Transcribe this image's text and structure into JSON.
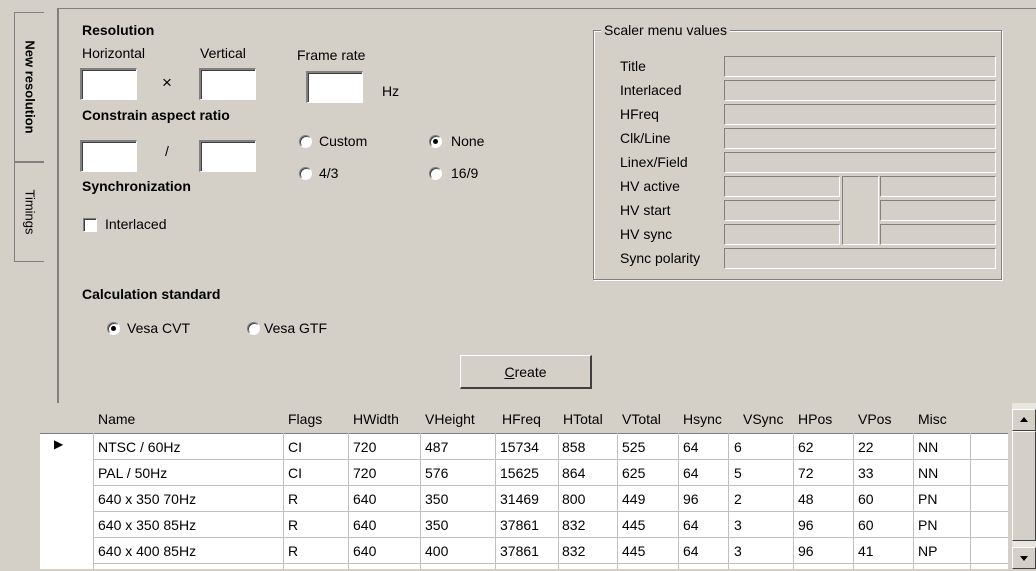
{
  "tabs": [
    "New resolution",
    "Timings"
  ],
  "resolution": {
    "heading": "Resolution",
    "horizontal_label": "Horizontal",
    "vertical_label": "Vertical",
    "horizontal_value": "",
    "vertical_value": "",
    "times": "×",
    "frame_rate_label": "Frame rate",
    "frame_rate_value": "",
    "hz": "Hz"
  },
  "aspect": {
    "heading": "Constrain aspect ratio",
    "slash": "/",
    "num_value": "",
    "den_value": "",
    "options": [
      {
        "label": "Custom",
        "selected": false
      },
      {
        "label": "None",
        "selected": true
      },
      {
        "label": "4/3",
        "selected": false
      },
      {
        "label": "16/9",
        "selected": false
      }
    ]
  },
  "sync": {
    "heading": "Synchronization",
    "interlaced_label": "Interlaced",
    "interlaced_checked": false
  },
  "calc": {
    "heading": "Calculation standard",
    "options": [
      {
        "label": "Vesa CVT",
        "selected": true
      },
      {
        "label": "Vesa GTF",
        "selected": false
      }
    ]
  },
  "create_button": {
    "prefix": "C",
    "rest": "reate"
  },
  "scaler": {
    "title": "Scaler menu values",
    "labels": [
      "Title",
      "Interlaced",
      "HFreq",
      "Clk/Line",
      "Linex/Field",
      "HV active",
      "HV start",
      "HV sync",
      "Sync polarity"
    ]
  },
  "table": {
    "columns": [
      "Name",
      "Flags",
      "HWidth",
      "VHeight",
      "HFreq",
      "HTotal",
      "VTotal",
      "Hsync",
      "VSync",
      "HPos",
      "VPos",
      "Misc"
    ],
    "rows": [
      [
        "NTSC / 60Hz",
        "CI",
        "720",
        "487",
        "15734",
        "858",
        "525",
        "64",
        "6",
        "62",
        "22",
        "NN"
      ],
      [
        "PAL / 50Hz",
        "CI",
        "720",
        "576",
        "15625",
        "864",
        "625",
        "64",
        "5",
        "72",
        "33",
        "NN"
      ],
      [
        "640 x 350 70Hz",
        "R",
        "640",
        "350",
        "31469",
        "800",
        "449",
        "96",
        "2",
        "48",
        "60",
        "PN"
      ],
      [
        "640 x 350 85Hz",
        "R",
        "640",
        "350",
        "37861",
        "832",
        "445",
        "64",
        "3",
        "96",
        "60",
        "PN"
      ],
      [
        "640 x 400 85Hz",
        "R",
        "640",
        "400",
        "37861",
        "832",
        "445",
        "64",
        "3",
        "96",
        "41",
        "NP"
      ]
    ],
    "current_row_indicator": "▶"
  }
}
